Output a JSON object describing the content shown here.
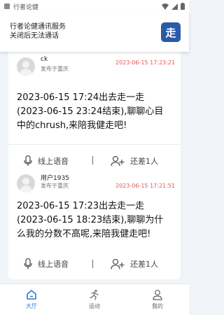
{
  "status_bar": {
    "app_name": "行者论健",
    "icons": [
      "wifi-icon",
      "signal-icon",
      "battery-icon"
    ]
  },
  "notification": {
    "line1": "行者论健通讯服务",
    "line2": "关闭后无法通话",
    "logo_text": "走"
  },
  "cards": [
    {
      "username": "ck",
      "location": "发布于重庆",
      "time": "2023-06-15 17:23:21",
      "message": "2023-06-15 17:24出去走一走(2023-06-15 23:24结束),聊聊心目中的chrush,来陪我健走吧!",
      "voice_label": "线上语音",
      "join_label": "还差1人"
    },
    {
      "username": "用户1935",
      "location": "发布于重庆",
      "time": "2023-06-15 17:21:51",
      "message": "2023-06-15 17:23出去走一走(2023-06-15 18:23结束),聊聊为什么我的分数不高呢,来陪我健走吧!",
      "voice_label": "线上语音",
      "join_label": "还差1人"
    }
  ],
  "tabbar": {
    "items": [
      {
        "label": "大厅",
        "icon": "home-icon",
        "active": true
      },
      {
        "label": "运动",
        "icon": "running-icon",
        "active": false
      },
      {
        "label": "我的",
        "icon": "user-icon",
        "active": false
      }
    ]
  },
  "colors": {
    "accent": "#2d7ad6",
    "time_red": "#e8534f",
    "background": "#f0f4f8"
  }
}
